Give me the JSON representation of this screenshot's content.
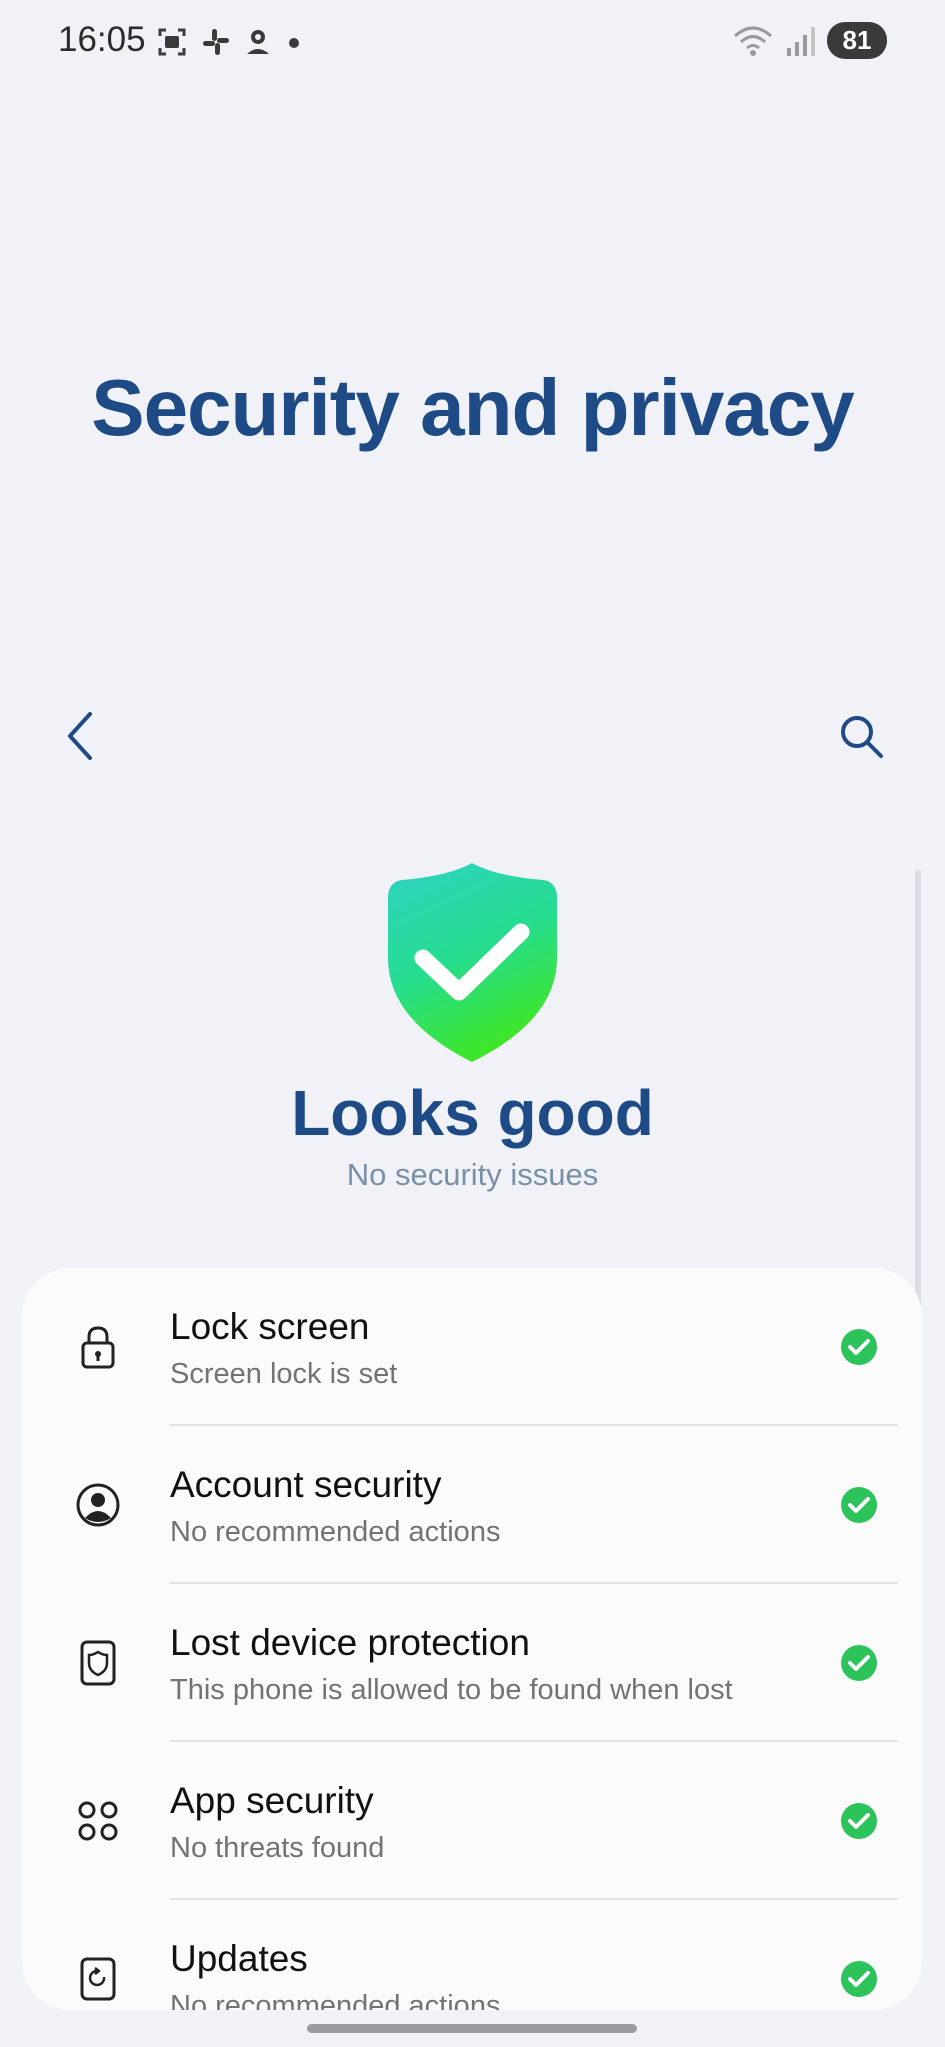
{
  "status_bar": {
    "time": "16:05",
    "left_icons": [
      "screenshot-icon",
      "slack-icon",
      "find-my-device-icon",
      "dot-icon"
    ],
    "right_icons": [
      "wifi-icon",
      "signal-icon"
    ],
    "battery": "81"
  },
  "header": {
    "title": "Security and privacy"
  },
  "hero": {
    "status_title": "Looks good",
    "status_subtitle": "No security issues"
  },
  "items": [
    {
      "icon": "lock-icon",
      "title": "Lock screen",
      "subtitle": "Screen lock is set"
    },
    {
      "icon": "account-icon",
      "title": "Account security",
      "subtitle": "No recommended actions"
    },
    {
      "icon": "lost-device-icon",
      "title": "Lost device protection",
      "subtitle": "This phone is allowed to be found when lost"
    },
    {
      "icon": "app-security-icon",
      "title": "App security",
      "subtitle": "No threats found"
    },
    {
      "icon": "updates-icon",
      "title": "Updates",
      "subtitle": "No recommended actions"
    }
  ],
  "colors": {
    "background": "#f1f2f7",
    "title": "#1e4a86",
    "check_green": "#2cc35a",
    "card": "#fbfbfc"
  }
}
